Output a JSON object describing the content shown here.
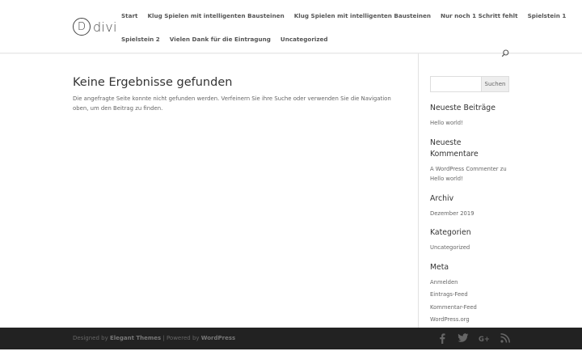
{
  "logo": {
    "mark": "D",
    "text": "divi"
  },
  "nav": {
    "row1": [
      "Start",
      "Klug Spielen mit intelligenten Bausteinen",
      "Klug Spielen mit intelligenten Bausteinen",
      "Nur noch 1 Schritt fehlt",
      "Spielstein 1"
    ],
    "row2": [
      "Spielstein 2",
      "Vielen Dank für die Eintragung",
      "Uncategorized"
    ]
  },
  "main": {
    "title": "Keine Ergebnisse gefunden",
    "message": "Die angefragte Seite konnte nicht gefunden werden. Verfeinern Sie ihre Suche oder verwenden Sie die Navigation oben, um den Beitrag zu finden."
  },
  "sidebar": {
    "search": {
      "value": "",
      "button": "Suchen"
    },
    "recent_posts": {
      "title": "Neueste Beiträge",
      "items": [
        "Hello world!"
      ]
    },
    "recent_comments": {
      "title": "Neueste Kommentare",
      "author": "A WordPress Commenter",
      "connector": "zu",
      "post": "Hello world!"
    },
    "archive": {
      "title": "Archiv",
      "items": [
        "Dezember 2019"
      ]
    },
    "categories": {
      "title": "Kategorien",
      "items": [
        "Uncategorized"
      ]
    },
    "meta": {
      "title": "Meta",
      "items": [
        "Anmelden",
        "Eintrags-Feed",
        "Kommentar-Feed",
        "WordPress.org"
      ]
    }
  },
  "footer": {
    "designed_by": "Designed by",
    "theme": "Elegant Themes",
    "separator": "|",
    "powered_by": "Powered by",
    "platform": "WordPress",
    "socials": [
      "facebook-icon",
      "twitter-icon",
      "google-plus-icon",
      "rss-icon"
    ]
  },
  "colors": {
    "footer_bg": "#222222",
    "text": "#666666",
    "heading": "#333333"
  }
}
